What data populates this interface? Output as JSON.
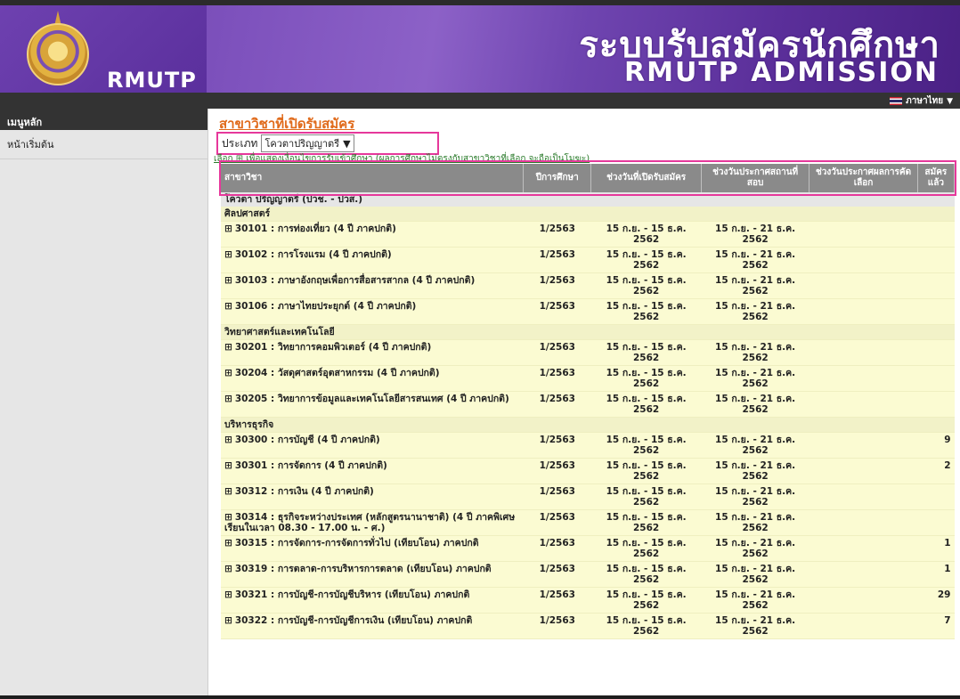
{
  "header": {
    "logo_text": "RMUTP",
    "brand_th": "ระบบรับสมัครนักศึกษา",
    "brand_en": "RMUTP ADMISSION"
  },
  "topbar": {
    "language": "ภาษาไทย"
  },
  "sidebar": {
    "heading": "เมนูหลัก",
    "items": [
      {
        "label": "หน้าเริ่มต้น"
      }
    ]
  },
  "main": {
    "title": "สาขาวิชาที่เปิดรับสมัคร",
    "type_label": "ประเภท",
    "type_value": "โควตาปริญญาตรี",
    "note": "เลือก ⊞ เพื่อแสดงเงื่อนไขการรับเข้าศึกษา (ผลการศึกษาไม่ตรงกับสาขาวิชาที่เลือก จะถือเป็นโมฆะ)",
    "columns": [
      "สาขาวิชา",
      "ปีการศึกษา",
      "ช่วงวันที่เปิดรับสมัคร",
      "ช่วงวันประกาศสถานที่สอบ",
      "ช่วงวันประกาศผลการคัดเลือก",
      "สมัครแล้ว"
    ],
    "group": "โควตา ปริญญาตรี (ปวช. - ปวส.)",
    "categories": [
      {
        "name": "ศิลปศาสตร์",
        "rows": [
          {
            "program": "30101 : การท่องเที่ยว (4 ปี ภาคปกติ)",
            "year": "1/2563",
            "open": "15 ก.ย. - 15 ธ.ค. 2562",
            "exam": "15 ก.ย. - 21 ธ.ค. 2562",
            "result": "",
            "applied": ""
          },
          {
            "program": "30102 : การโรงแรม (4 ปี ภาคปกติ)",
            "year": "1/2563",
            "open": "15 ก.ย. - 15 ธ.ค. 2562",
            "exam": "15 ก.ย. - 21 ธ.ค. 2562",
            "result": "",
            "applied": ""
          },
          {
            "program": "30103 : ภาษาอังกฤษเพื่อการสื่อสารสากล (4 ปี ภาคปกติ)",
            "year": "1/2563",
            "open": "15 ก.ย. - 15 ธ.ค. 2562",
            "exam": "15 ก.ย. - 21 ธ.ค. 2562",
            "result": "",
            "applied": ""
          },
          {
            "program": "30106 : ภาษาไทยประยุกต์ (4 ปี ภาคปกติ)",
            "year": "1/2563",
            "open": "15 ก.ย. - 15 ธ.ค. 2562",
            "exam": "15 ก.ย. - 21 ธ.ค. 2562",
            "result": "",
            "applied": ""
          }
        ]
      },
      {
        "name": "วิทยาศาสตร์และเทคโนโลยี",
        "rows": [
          {
            "program": "30201 : วิทยาการคอมพิวเตอร์ (4 ปี ภาคปกติ)",
            "year": "1/2563",
            "open": "15 ก.ย. - 15 ธ.ค. 2562",
            "exam": "15 ก.ย. - 21 ธ.ค. 2562",
            "result": "",
            "applied": ""
          },
          {
            "program": "30204 : วัสดุศาสตร์อุตสาหกรรม (4 ปี ภาคปกติ)",
            "year": "1/2563",
            "open": "15 ก.ย. - 15 ธ.ค. 2562",
            "exam": "15 ก.ย. - 21 ธ.ค. 2562",
            "result": "",
            "applied": ""
          },
          {
            "program": "30205 : วิทยาการข้อมูลและเทคโนโลยีสารสนเทศ (4 ปี ภาคปกติ)",
            "year": "1/2563",
            "open": "15 ก.ย. - 15 ธ.ค. 2562",
            "exam": "15 ก.ย. - 21 ธ.ค. 2562",
            "result": "",
            "applied": ""
          }
        ]
      },
      {
        "name": "บริหารธุรกิจ",
        "rows": [
          {
            "program": "30300 : การบัญชี (4 ปี ภาคปกติ)",
            "year": "1/2563",
            "open": "15 ก.ย. - 15 ธ.ค. 2562",
            "exam": "15 ก.ย. - 21 ธ.ค. 2562",
            "result": "",
            "applied": "9"
          },
          {
            "program": "30301 : การจัดการ (4 ปี ภาคปกติ)",
            "year": "1/2563",
            "open": "15 ก.ย. - 15 ธ.ค. 2562",
            "exam": "15 ก.ย. - 21 ธ.ค. 2562",
            "result": "",
            "applied": "2"
          },
          {
            "program": "30312 : การเงิน (4 ปี ภาคปกติ)",
            "year": "1/2563",
            "open": "15 ก.ย. - 15 ธ.ค. 2562",
            "exam": "15 ก.ย. - 21 ธ.ค. 2562",
            "result": "",
            "applied": ""
          },
          {
            "program": "30314 : ธุรกิจระหว่างประเทศ (หลักสูตรนานาชาติ) (4 ปี ภาคพิเศษ เรียนในเวลา 08.30 - 17.00 น. - ศ.)",
            "year": "1/2563",
            "open": "15 ก.ย. - 15 ธ.ค. 2562",
            "exam": "15 ก.ย. - 21 ธ.ค. 2562",
            "result": "",
            "applied": ""
          },
          {
            "program": "30315 : การจัดการ-การจัดการทั่วไป (เทียบโอน) ภาคปกติ",
            "year": "1/2563",
            "open": "15 ก.ย. - 15 ธ.ค. 2562",
            "exam": "15 ก.ย. - 21 ธ.ค. 2562",
            "result": "",
            "applied": "1"
          },
          {
            "program": "30319 : การตลาด-การบริหารการตลาด (เทียบโอน) ภาคปกติ",
            "year": "1/2563",
            "open": "15 ก.ย. - 15 ธ.ค. 2562",
            "exam": "15 ก.ย. - 21 ธ.ค. 2562",
            "result": "",
            "applied": "1"
          },
          {
            "program": "30321 : การบัญชี-การบัญชีบริหาร (เทียบโอน) ภาคปกติ",
            "year": "1/2563",
            "open": "15 ก.ย. - 15 ธ.ค. 2562",
            "exam": "15 ก.ย. - 21 ธ.ค. 2562",
            "result": "",
            "applied": "29"
          },
          {
            "program": "30322 : การบัญชี-การบัญชีการเงิน (เทียบโอน) ภาคปกติ",
            "year": "1/2563",
            "open": "15 ก.ย. - 15 ธ.ค. 2562",
            "exam": "15 ก.ย. - 21 ธ.ค. 2562",
            "result": "",
            "applied": "7"
          }
        ]
      }
    ]
  }
}
